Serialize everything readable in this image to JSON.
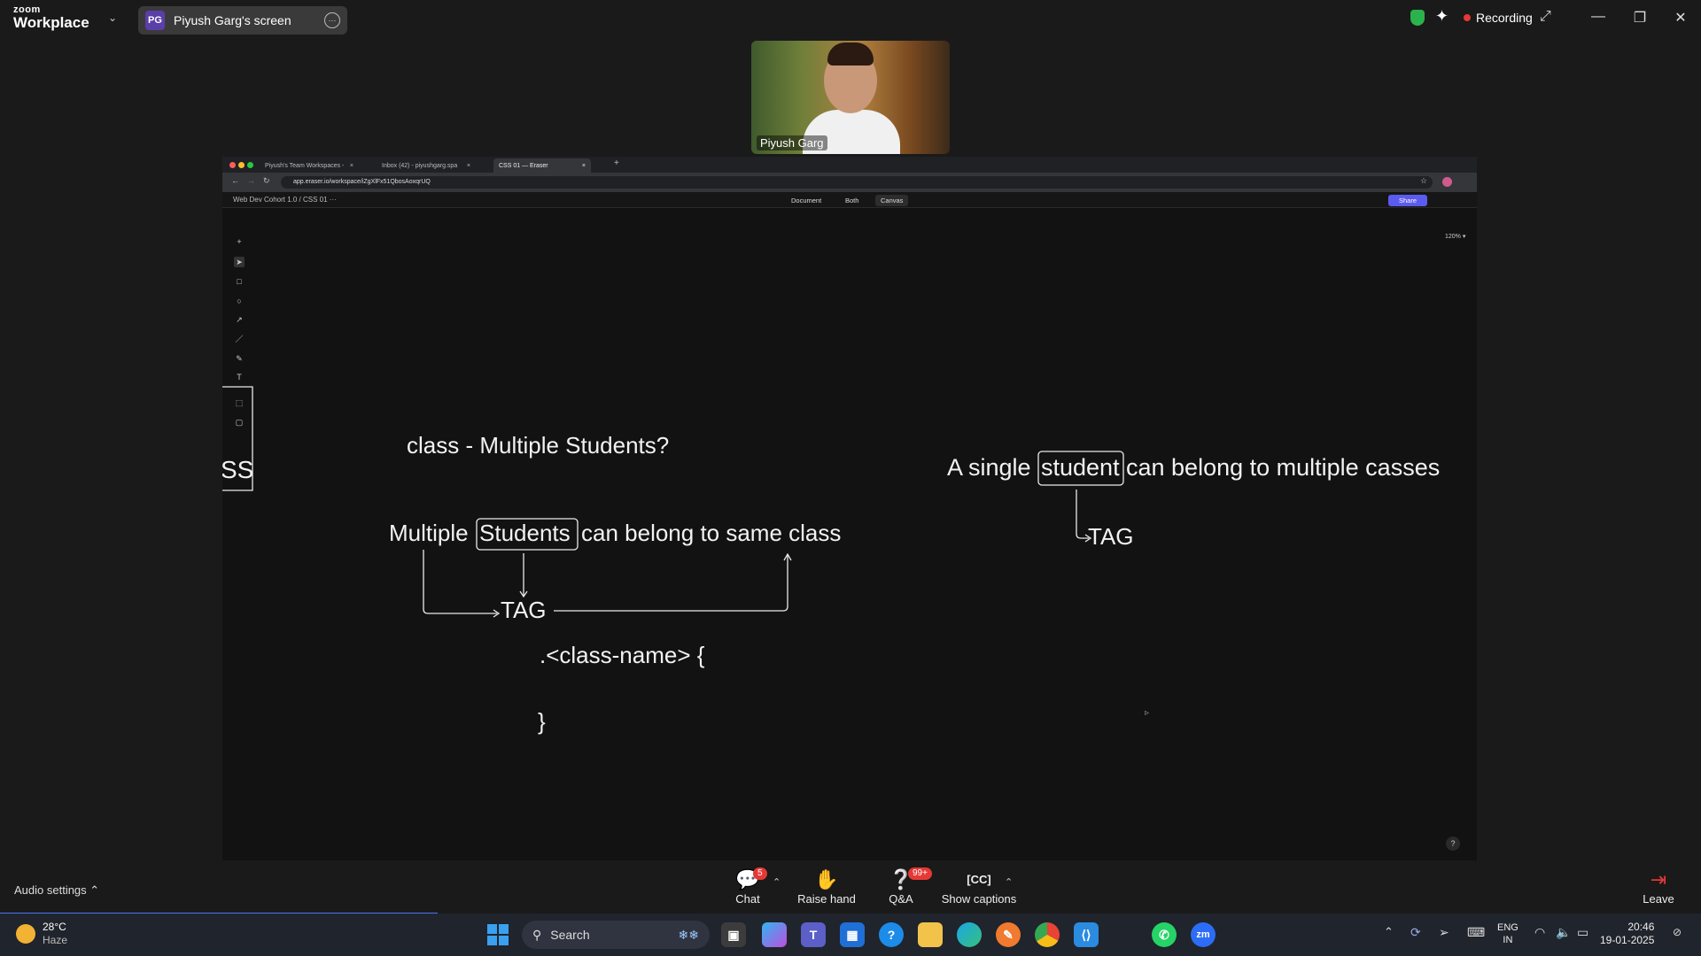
{
  "zoom": {
    "logo_top": "zoom",
    "logo_bottom": "Workplace",
    "share_initials": "PG",
    "share_title": "Piyush Garg's screen",
    "recording_label": "Recording",
    "participant_name": "Piyush Garg"
  },
  "browser": {
    "tabs": [
      {
        "label": "Piyush's Team Workspaces -"
      },
      {
        "label": "Inbox (42) - piyushgarg.spa"
      },
      {
        "label": "CSS 01 — Eraser"
      }
    ],
    "url": "app.eraser.io/workspace/iZgXlFx51QbosAoxqrUQ"
  },
  "eraser": {
    "breadcrumb": "Web Dev Cohort 1.0  /  CSS 01  ···",
    "view_tabs": [
      "Document",
      "Both",
      "Canvas"
    ],
    "share_label": "Share",
    "zoom_level": "120% ▾",
    "help": "?"
  },
  "canvas": {
    "edge_text": "SS",
    "question": "class - Multiple Students?",
    "line1_pre": "Multiple",
    "line1_box": "Students",
    "line1_post": "can belong to same class",
    "tag_left": "TAG",
    "code_open": ".<class-name> {",
    "code_close": "}",
    "line2_pre": "A single",
    "line2_box": "student",
    "line2_post": "can belong to multiple casses",
    "tag_right": "TAG"
  },
  "controls": {
    "audio_settings": "Audio settings",
    "chat": "Chat",
    "chat_badge": "5",
    "raise_hand": "Raise hand",
    "qa": "Q&A",
    "qa_badge": "99+",
    "captions": "Show captions",
    "leave": "Leave"
  },
  "taskbar": {
    "temp": "28°C",
    "weather": "Haze",
    "search": "Search",
    "lang1": "ENG",
    "lang2": "IN",
    "time": "20:46",
    "date": "19-01-2025"
  }
}
